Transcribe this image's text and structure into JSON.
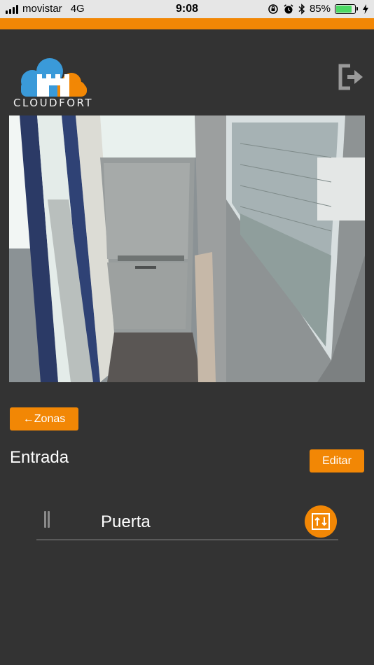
{
  "status_bar": {
    "carrier": "movistar",
    "network": "4G",
    "time": "9:08",
    "battery": "85%",
    "battery_level": 0.85,
    "icons": [
      "signal-icon",
      "orientation-lock-icon",
      "alarm-icon",
      "bluetooth-icon",
      "battery-icon",
      "charging-icon"
    ]
  },
  "brand": {
    "logo_text": "CLOUDFORT",
    "accent_color": "#f28705",
    "logo_blue": "#3a9ad9",
    "logo_orange": "#f28705"
  },
  "header": {
    "logout_icon": "logout-icon"
  },
  "camera": {
    "description_icon": "camera-feed"
  },
  "nav": {
    "back_label": "←Zonas"
  },
  "zone": {
    "title": "Entrada",
    "edit_label": "Editar"
  },
  "devices": [
    {
      "name": "Puerta",
      "action_icon": "open-door-icon",
      "handle_icon": "drag-handle-icon"
    }
  ]
}
